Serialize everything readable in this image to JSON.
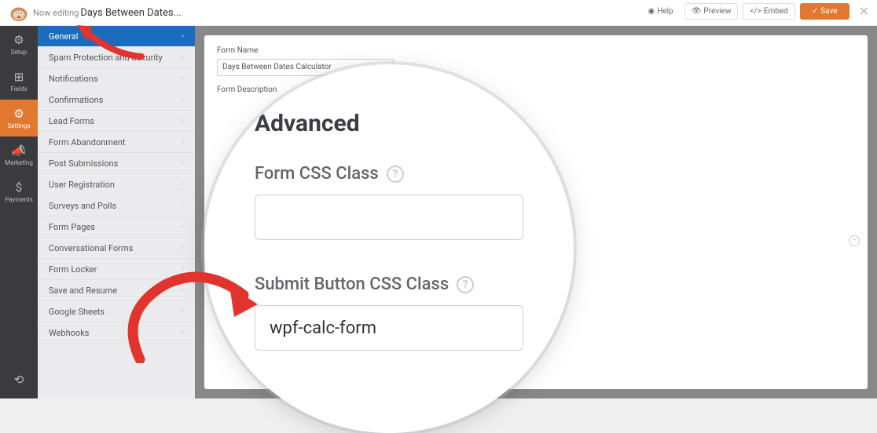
{
  "header": {
    "now_editing_label": "Now editing",
    "form_title": "Days Between Dates...",
    "help": "Help",
    "preview": "Preview",
    "embed": "Embed",
    "save": "Save"
  },
  "rail": [
    {
      "id": "setup",
      "label": "Setup",
      "icon": "⚙"
    },
    {
      "id": "fields",
      "label": "Fields",
      "icon": "⊞"
    },
    {
      "id": "settings",
      "label": "Settings",
      "icon": "⚙",
      "active": true
    },
    {
      "id": "marketing",
      "label": "Marketing",
      "icon": "📣"
    },
    {
      "id": "payments",
      "label": "Payments",
      "icon": "$"
    }
  ],
  "rail_revisions_icon": "⟲",
  "sidebar": [
    {
      "label": "General",
      "active": true
    },
    {
      "label": "Spam Protection and Security"
    },
    {
      "label": "Notifications"
    },
    {
      "label": "Confirmations"
    },
    {
      "label": "Lead Forms"
    },
    {
      "label": "Form Abandonment"
    },
    {
      "label": "Post Submissions"
    },
    {
      "label": "User Registration"
    },
    {
      "label": "Surveys and Polls"
    },
    {
      "label": "Form Pages"
    },
    {
      "label": "Conversational Forms"
    },
    {
      "label": "Form Locker"
    },
    {
      "label": "Save and Resume"
    },
    {
      "label": "Google Sheets"
    },
    {
      "label": "Webhooks"
    }
  ],
  "main": {
    "form_name_label": "Form Name",
    "form_name_value": "Days Between Dates Calculator",
    "form_description_label": "Form Description"
  },
  "zoom": {
    "section_title": "Advanced",
    "form_css_label": "Form CSS Class",
    "form_css_value": "",
    "submit_css_label": "Submit Button CSS Class",
    "submit_css_value": "wpf-calc-form",
    "help_glyph": "?"
  }
}
